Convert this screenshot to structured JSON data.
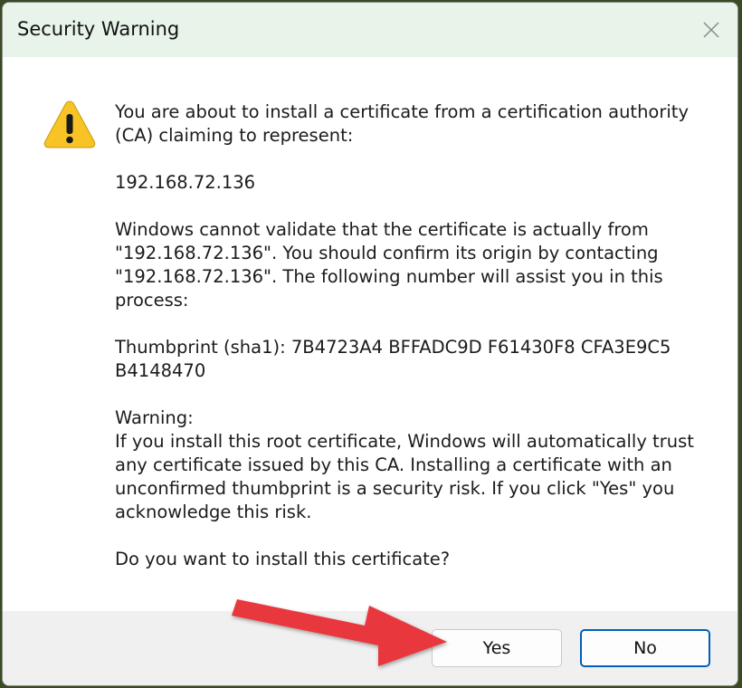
{
  "window": {
    "title": "Security Warning"
  },
  "icons": {
    "warning": "warning-icon",
    "close": "close-icon",
    "annotation_arrow": "arrow-icon"
  },
  "message": {
    "intro": "You are about to install a certificate from a certification authority (CA) claiming to represent:",
    "host": "192.168.72.136",
    "validation": "Windows cannot validate that the certificate is actually from \"192.168.72.136\". You should confirm its origin by contacting \"192.168.72.136\". The following number will assist you in this process:",
    "thumbprint_line1": "Thumbprint (sha1): 7B4723A4 BFFADC9D F61430F8 CFA3E9C5",
    "thumbprint_line2": "B4148470",
    "warning_heading": "Warning:",
    "warning_body": "If you install this root certificate, Windows will automatically trust any certificate issued by this CA. Installing a certificate with an unconfirmed thumbprint is a security risk. If you click \"Yes\" you acknowledge this risk.",
    "question": "Do you want to install this certificate?"
  },
  "buttons": {
    "yes_label": "Yes",
    "no_label": "No"
  },
  "colors": {
    "titlebar": "#e8f3ea",
    "focus_border": "#005fb8",
    "warning_fill": "#f7c325",
    "arrow": "#e8393e"
  }
}
